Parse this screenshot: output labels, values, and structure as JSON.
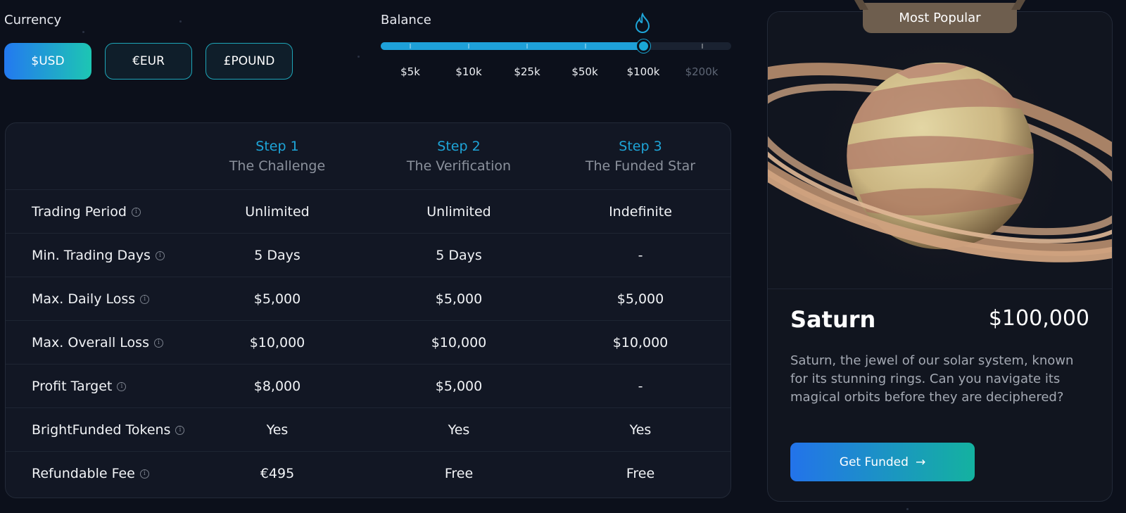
{
  "currency": {
    "label": "Currency",
    "options": [
      "$USD",
      "€EUR",
      "£POUND"
    ],
    "selected": "$USD"
  },
  "balance": {
    "label": "Balance",
    "options": [
      "$5k",
      "$10k",
      "$25k",
      "$50k",
      "$100k",
      "$200k"
    ],
    "selected": "$100k",
    "selected_index": 4
  },
  "table": {
    "steps": [
      {
        "step": "Step 1",
        "name": "The Challenge"
      },
      {
        "step": "Step 2",
        "name": "The Verification"
      },
      {
        "step": "Step 3",
        "name": "The Funded Star"
      }
    ],
    "rows": [
      {
        "label": "Trading Period",
        "values": [
          "Unlimited",
          "Unlimited",
          "Indefinite"
        ]
      },
      {
        "label": "Min. Trading Days",
        "values": [
          "5 Days",
          "5 Days",
          "-"
        ]
      },
      {
        "label": "Max. Daily Loss",
        "values": [
          "$5,000",
          "$5,000",
          "$5,000"
        ]
      },
      {
        "label": "Max. Overall Loss",
        "values": [
          "$10,000",
          "$10,000",
          "$10,000"
        ]
      },
      {
        "label": "Profit Target",
        "values": [
          "$8,000",
          "$5,000",
          "-"
        ]
      },
      {
        "label": "BrightFunded Tokens",
        "values": [
          "Yes",
          "Yes",
          "Yes"
        ]
      },
      {
        "label": "Refundable Fee",
        "values": [
          "€495",
          "Free",
          "Free"
        ]
      }
    ]
  },
  "plan": {
    "badge": "Most Popular",
    "name": "Saturn",
    "price": "$100,000",
    "description": "Saturn, the jewel of our solar system, known for its stunning rings. Can you navigate its magical orbits before they are deciphered?",
    "cta_label": "Get Funded",
    "cta_icon": "arrow-right-icon",
    "image": "saturn-planet-illustration"
  },
  "colors": {
    "background": "#0c101b",
    "accent_blue": "#1ea5d8",
    "gradient_start": "#2379f0",
    "gradient_end": "#1dc6b3",
    "badge": "#6e5e4e"
  }
}
